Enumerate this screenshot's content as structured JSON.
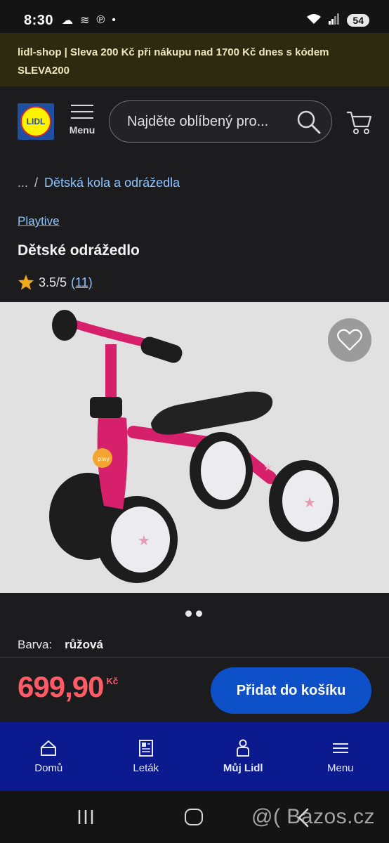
{
  "status_bar": {
    "time": "8:30",
    "battery": "54"
  },
  "promo": {
    "text": "lidl-shop | Sleva 200 Kč při nákupu nad 1700 Kč dnes s kódem SLEVA200"
  },
  "header": {
    "logo_text": "LIDL",
    "menu_label": "Menu",
    "search_placeholder": "Najděte oblíbený pro..."
  },
  "breadcrumb": {
    "ellipsis": "...",
    "separator": "/",
    "category": "Dětská kola a odrážedla"
  },
  "product": {
    "brand": "Playtive",
    "title": "Dětské odrážedlo",
    "rating": "3.5/5",
    "rating_count": "(11)",
    "color_label": "Barva:",
    "color_value": "růžová",
    "price": "699,90",
    "currency": "Kč",
    "add_to_cart": "Přidat do košíku",
    "image_slides": 2,
    "active_slide": 1
  },
  "bottom_nav": {
    "items": [
      {
        "label": "Domů",
        "icon": "home-icon"
      },
      {
        "label": "Leták",
        "icon": "flyer-icon"
      },
      {
        "label": "Můj Lidl",
        "icon": "account-icon",
        "active": true
      },
      {
        "label": "Menu",
        "icon": "menu-icon"
      }
    ]
  },
  "watermark": "@( Bazos.cz",
  "colors": {
    "promo_bg": "#2e2a10",
    "link": "#8ec5ff",
    "price": "#ff5a66",
    "cta": "#0d50c8",
    "nav_bg": "#0c1a8f",
    "bike_frame": "#d6206b"
  }
}
